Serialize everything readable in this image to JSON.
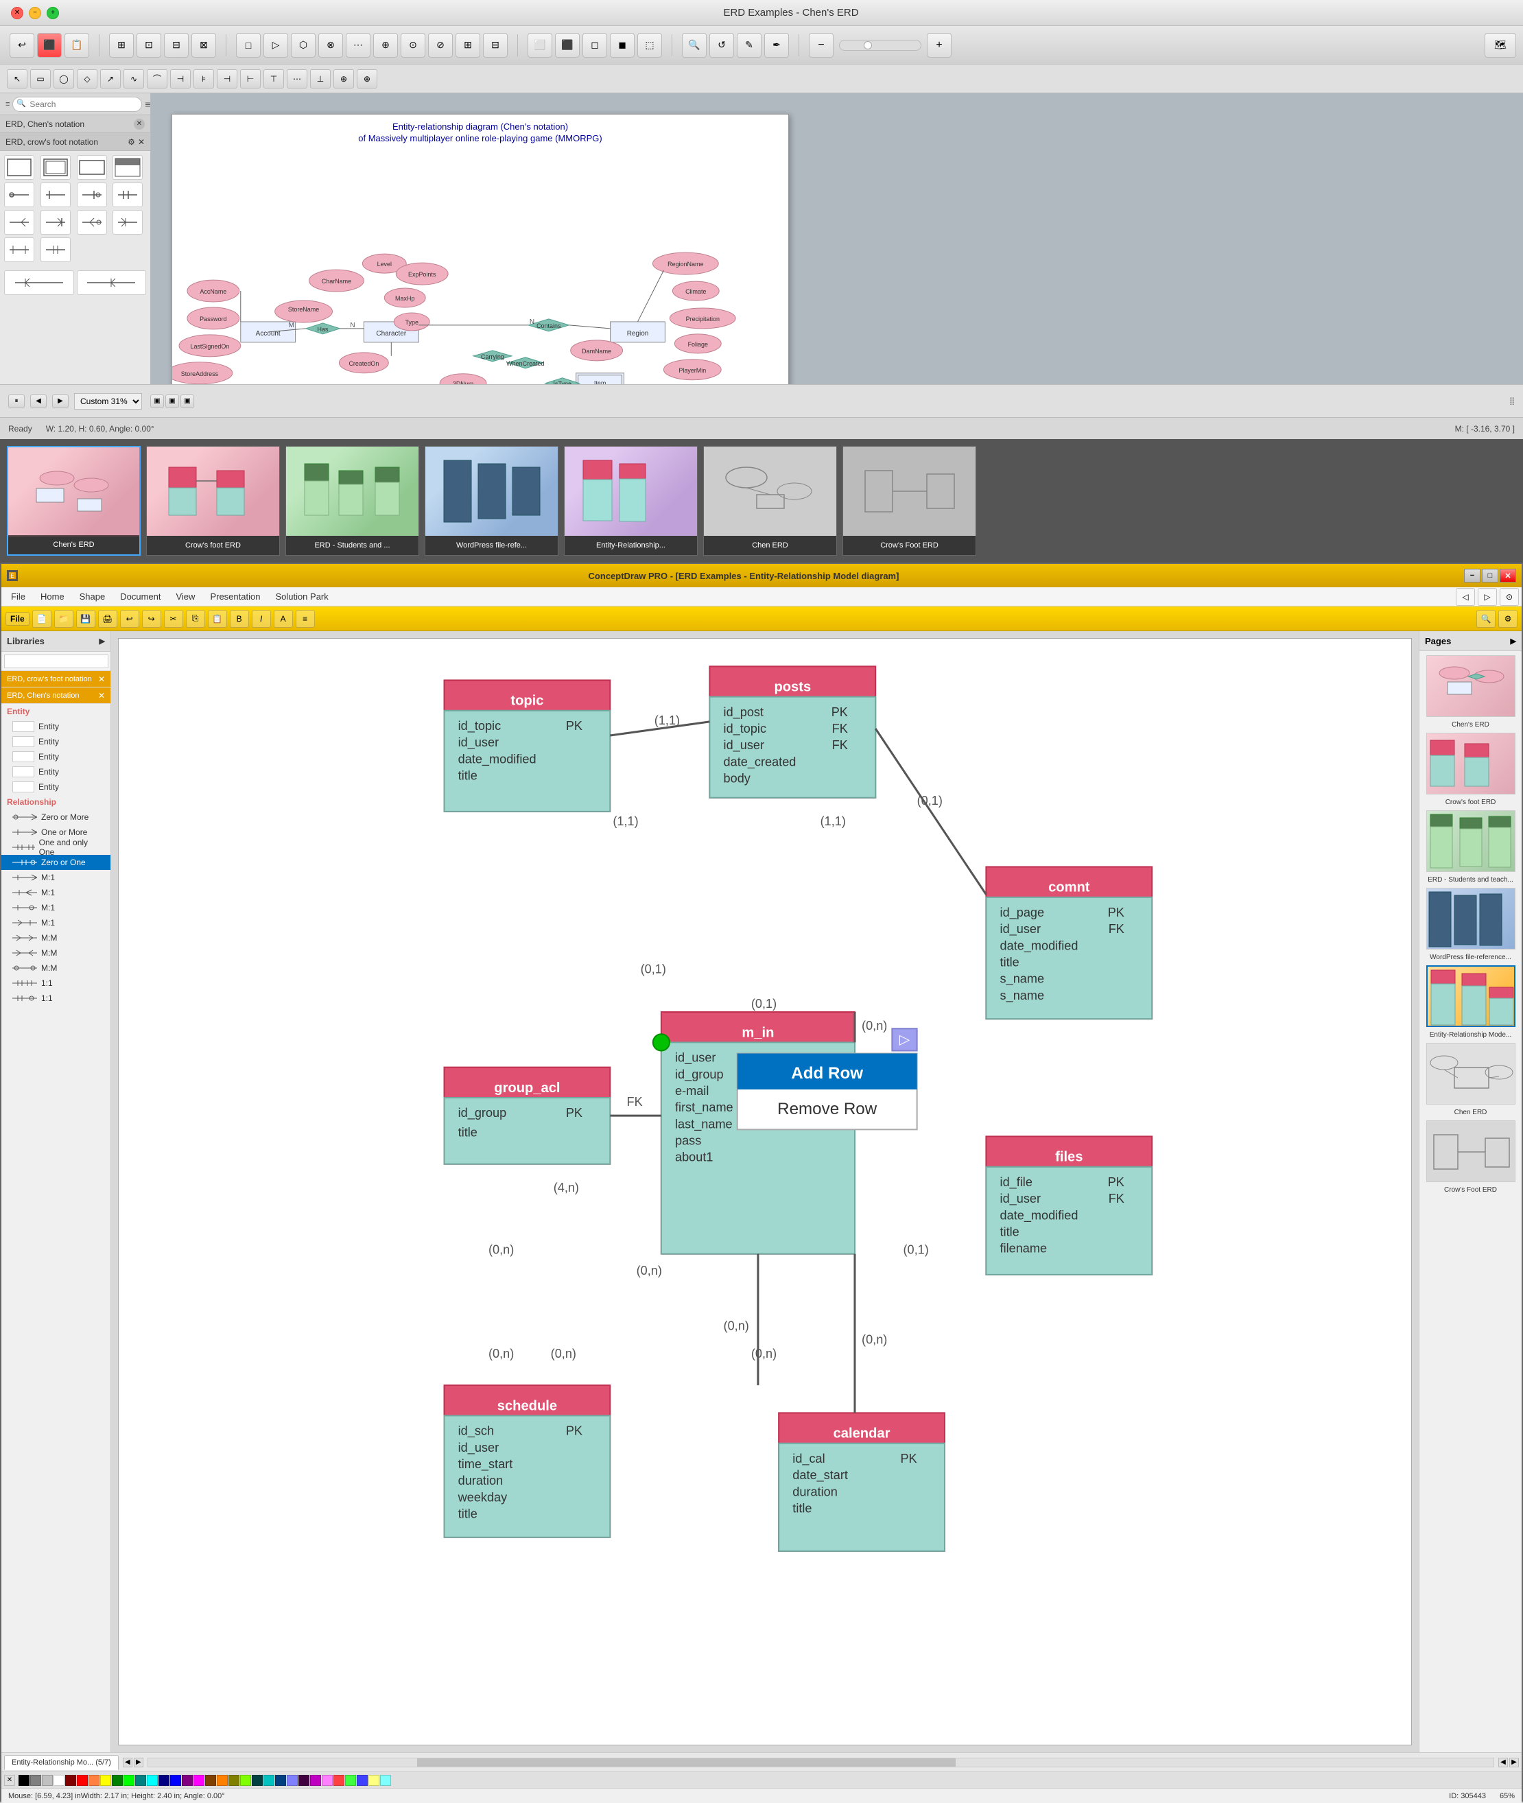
{
  "mac_window": {
    "title": "ERD Examples - Chen's ERD",
    "status": {
      "ready": "Ready",
      "dimensions": "W: 1.20, H: 0.60,  Angle: 0.00°",
      "mouse": "M: [ -3.16, 3.70 ]"
    },
    "playback": {
      "zoom_label": "Custom 31%"
    },
    "search": {
      "placeholder": "Search"
    },
    "libraries": [
      {
        "name": "ERD, Chen's notation",
        "active": false
      },
      {
        "name": "ERD, crow's foot notation",
        "active": true
      }
    ],
    "diagram_title_line1": "Entity-relationship diagram (Chen's notation)",
    "diagram_title_line2": "of Massively multiplayer online role-playing game (MMORPG)"
  },
  "thumbnails": [
    {
      "label": "Chen's ERD",
      "type": "pink"
    },
    {
      "label": "Crow's foot ERD",
      "type": "pink"
    },
    {
      "label": "ERD - Students and ...",
      "type": "green"
    },
    {
      "label": "WordPress file-refe...",
      "type": "blue"
    },
    {
      "label": "Entity-Relationship...",
      "type": "multi"
    },
    {
      "label": "Chen ERD",
      "type": "gray"
    },
    {
      "label": "Crow's Foot ERD",
      "type": "gray"
    }
  ],
  "win_window": {
    "title": "ConceptDraw PRO - [ERD Examples - Entity-Relationship Model diagram]",
    "menus": [
      "File",
      "Home",
      "Shape",
      "Document",
      "View",
      "Presentation",
      "Solution Park"
    ],
    "libraries": {
      "header": "Libraries",
      "search_placeholder": "",
      "items": [
        {
          "name": "ERD, crow's foot notation",
          "active": true
        },
        {
          "name": "ERD, Chen's notation",
          "active": true
        }
      ],
      "categories": {
        "entity": {
          "label": "Entity",
          "items": [
            "Entity",
            "Entity",
            "Entity",
            "Entity",
            "Entity"
          ]
        },
        "relationship": {
          "label": "Relationship",
          "items": [
            "Zero or More",
            "One or More",
            "One and only One",
            "Zero or One",
            "M:1",
            "M:1",
            "M:1",
            "M:1",
            "M:M",
            "M:M",
            "M:M",
            "1:1",
            "1:1"
          ]
        }
      }
    },
    "pages": {
      "header": "Pages",
      "items": [
        {
          "label": "Chen's ERD"
        },
        {
          "label": "Crow's foot ERD"
        },
        {
          "label": "ERD - Students and teach..."
        },
        {
          "label": "WordPress file-reference..."
        },
        {
          "label": "Entity-Relationship Mode...",
          "active": true
        },
        {
          "label": "Chen ERD"
        },
        {
          "label": "Crow's Foot ERD"
        }
      ]
    },
    "context_menu": {
      "items": [
        "Add Row",
        "Remove Row"
      ]
    },
    "statusbar": {
      "left": "Entity-Relationship Mo... (5/7)",
      "middle": "",
      "right_mouse": "Mouse: [6.59, 4.23] in",
      "right_dims": "Width: 2.17 in;  Height: 2.40 in;  Angle: 0.00°",
      "right_id": "ID: 305443",
      "zoom": "65%"
    },
    "color_palette": [
      "#000000",
      "#808080",
      "#c0c0c0",
      "#ffffff",
      "#800000",
      "#ff0000",
      "#ff8040",
      "#ffff00",
      "#008000",
      "#00ff00",
      "#008080",
      "#00ffff",
      "#000080",
      "#0000ff",
      "#800080",
      "#ff00ff",
      "#804000",
      "#ff8000",
      "#808000",
      "#80ff00",
      "#004040",
      "#00c0c0",
      "#004080",
      "#8080ff",
      "#400040",
      "#c000c0",
      "#ff80ff",
      "#ff4040",
      "#40ff40",
      "#4040ff",
      "#ffff80",
      "#80ffff",
      "#ff80ff"
    ]
  }
}
